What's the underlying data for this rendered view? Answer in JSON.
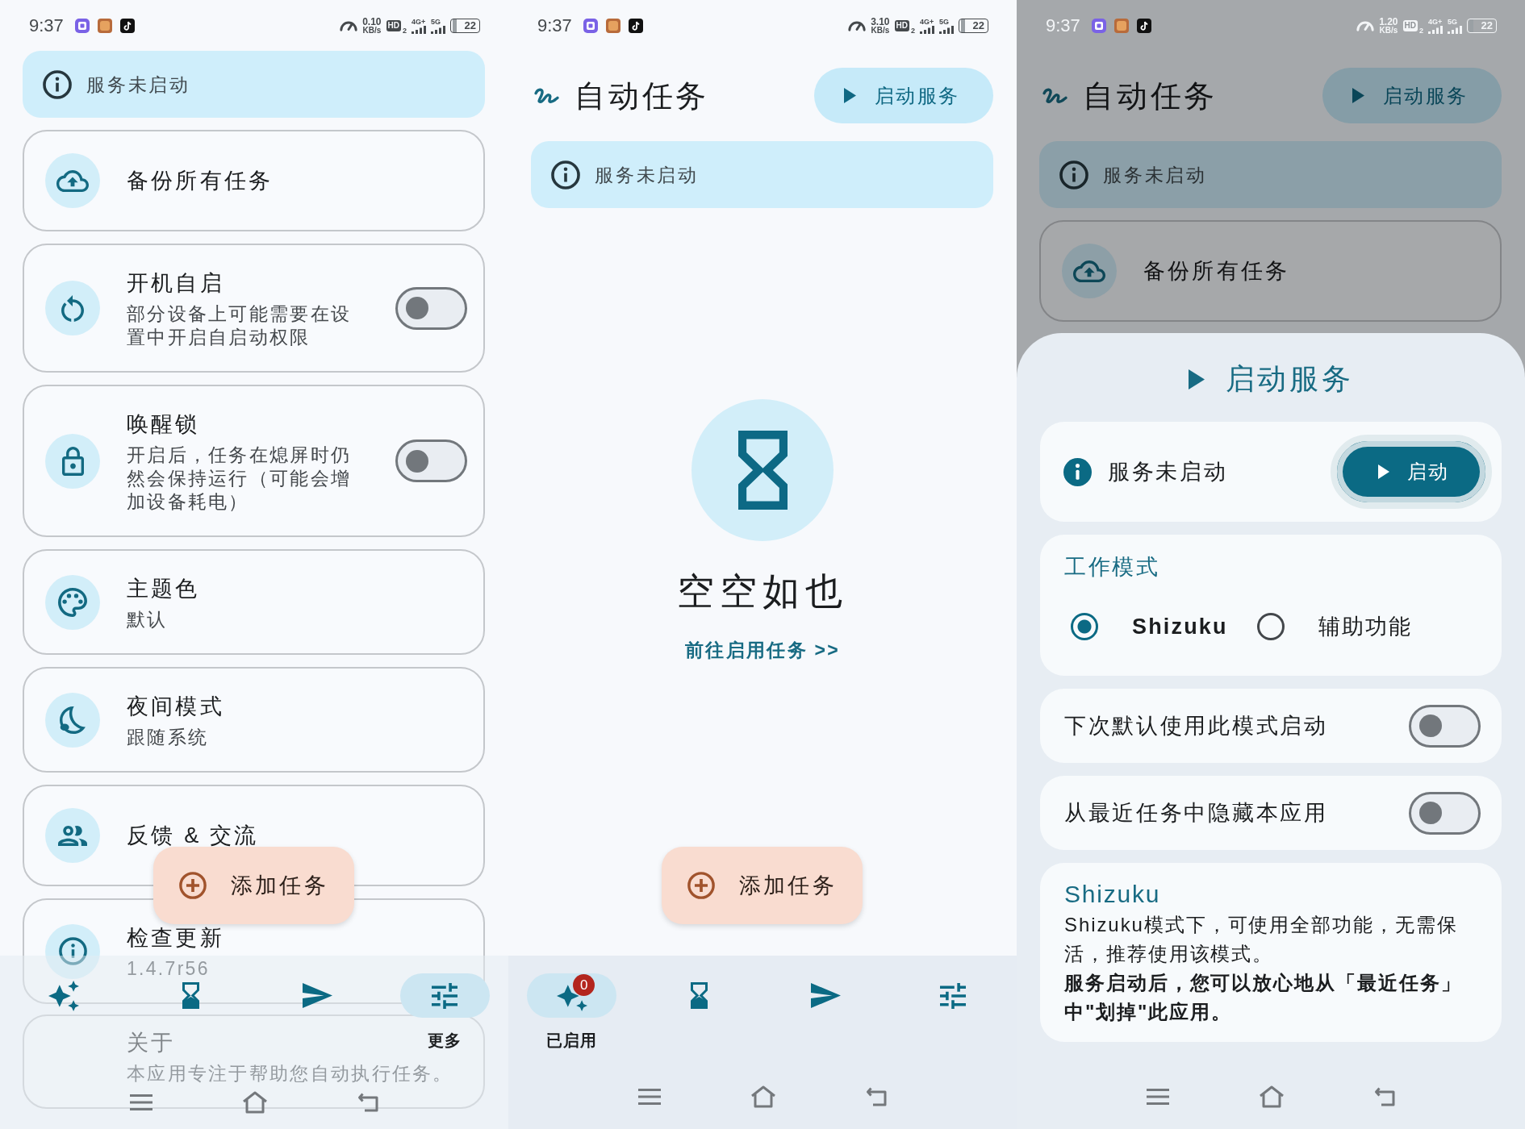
{
  "screens": [
    {
      "status_bar": {
        "time": "9:37",
        "net_speed": "0.10",
        "net_unit": "KB/s",
        "hd": "HD",
        "hd_sim": "2",
        "sim1": "4G+",
        "sim2": "5G",
        "battery": "22",
        "light_icons": false
      },
      "info_banner": {
        "text": "服务未启动"
      },
      "settings": [
        {
          "kind": "action",
          "title": "备份所有任务"
        },
        {
          "kind": "toggle",
          "title": "开机自启",
          "subtitle": "部分设备上可能需要在设置中开启自启动权限",
          "on": false
        },
        {
          "kind": "toggle",
          "title": "唤醒锁",
          "subtitle": "开启后，任务在熄屏时仍然会保持运行（可能会增加设备耗电）",
          "on": false
        },
        {
          "kind": "action",
          "title": "主题色",
          "subtitle": "默认"
        },
        {
          "kind": "action",
          "title": "夜间模式",
          "subtitle": "跟随系统"
        },
        {
          "kind": "action",
          "title": "反馈 & 交流"
        },
        {
          "kind": "action",
          "title": "检查更新",
          "subtitle": "1.4.7r56"
        },
        {
          "kind": "action",
          "title": "关于",
          "subtitle": "本应用专注于帮助您自动执行任务。"
        }
      ],
      "fab": {
        "label": "添加任务"
      },
      "bottom_nav": [
        {
          "selected": false
        },
        {
          "selected": false
        },
        {
          "selected": false
        },
        {
          "selected": true,
          "label": "更多"
        }
      ]
    },
    {
      "status_bar": {
        "time": "9:37",
        "net_speed": "3.10",
        "net_unit": "KB/s",
        "hd": "HD",
        "hd_sim": "2",
        "sim1": "4G+",
        "sim2": "5G",
        "battery": "22",
        "light_icons": false
      },
      "header": {
        "title": "自动任务",
        "action": "启动服务"
      },
      "info_banner": {
        "text": "服务未启动"
      },
      "empty_state": {
        "title": "空空如也",
        "link": "前往启用任务 >>"
      },
      "fab": {
        "label": "添加任务"
      },
      "bottom_nav": [
        {
          "selected": true,
          "label": "已启用",
          "badge": "0"
        },
        {
          "selected": false
        },
        {
          "selected": false
        },
        {
          "selected": false
        }
      ]
    },
    {
      "status_bar": {
        "time": "9:37",
        "net_speed": "1.20",
        "net_unit": "KB/s",
        "hd": "HD",
        "hd_sim": "2",
        "sim1": "4G+",
        "sim2": "5G",
        "battery": "22",
        "light_icons": true
      },
      "scrim": true,
      "header": {
        "title": "自动任务",
        "action": "启动服务"
      },
      "info_banner": {
        "text": "服务未启动"
      },
      "settings": [
        {
          "kind": "action",
          "title": "备份所有任务"
        }
      ],
      "sheet": {
        "title": "启动服务",
        "status": {
          "text": "服务未启动",
          "button": "启动",
          "focused": true
        },
        "mode": {
          "title": "工作模式",
          "options": [
            {
              "label": "Shizuku",
              "selected": true
            },
            {
              "label": "辅助功能",
              "selected": false
            }
          ]
        },
        "toggles": [
          {
            "label": "下次默认使用此模式启动",
            "on": false
          },
          {
            "label": "从最近任务中隐藏本应用",
            "on": false
          }
        ],
        "info": {
          "title": "Shizuku",
          "text": "Shizuku模式下，可使用全部功能，无需保活，推荐使用该模式。",
          "note": "服务启动后，您可以放心地从「最近任务」中\"划掉\"此应用。"
        }
      }
    }
  ]
}
